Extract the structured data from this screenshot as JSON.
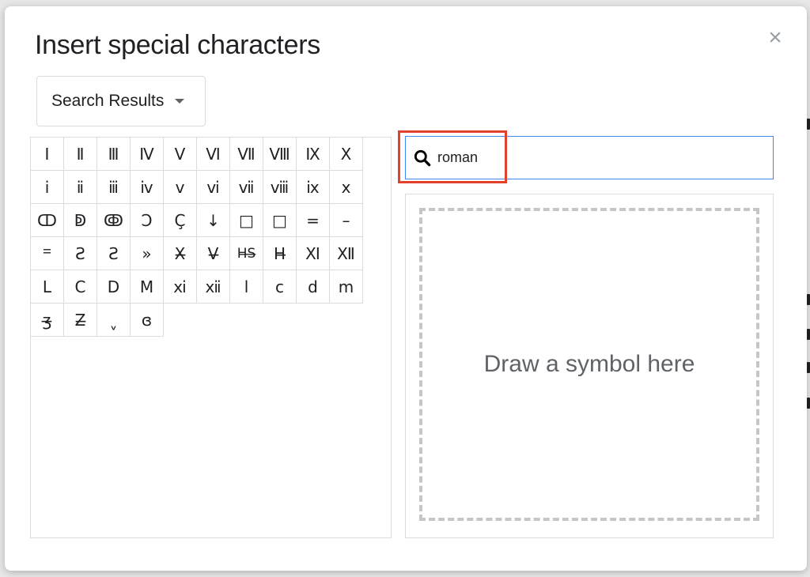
{
  "dialog": {
    "title": "Insert special characters",
    "close_glyph": "×"
  },
  "category": {
    "selected": "Search Results"
  },
  "characters": [
    "Ⅰ",
    "Ⅱ",
    "Ⅲ",
    "Ⅳ",
    "Ⅴ",
    "Ⅵ",
    "Ⅶ",
    "Ⅷ",
    "Ⅸ",
    "Ⅹ",
    "ⅰ",
    "ⅱ",
    "ⅲ",
    "ⅳ",
    "ⅴ",
    "ⅵ",
    "ⅶ",
    "ⅷ",
    "ⅸ",
    "ⅹ",
    "ↀ",
    "ↁ",
    "ↂ",
    "Ↄ",
    "Ç",
    "↓",
    "□",
    "□",
    "=",
    "–",
    "𐆐",
    "Ƨ",
    "Ƨ",
    "»",
    "X̶",
    "V̶",
    "H̶S̶",
    "H̶",
    "Ⅺ",
    "Ⅻ",
    "Ⅼ",
    "Ⅽ",
    "Ⅾ",
    "Ⅿ",
    "ⅺ",
    "ⅻ",
    "ⅼ",
    "ⅽ",
    "ⅾ",
    "ⅿ",
    "ʒ̶",
    "Z̶",
    "ˬ",
    "ɞ"
  ],
  "search": {
    "value": "roman",
    "icon": "search-icon"
  },
  "draw": {
    "prompt": "Draw a symbol here"
  },
  "colors": {
    "accent": "#4285f4",
    "highlight": "#e2412f"
  }
}
